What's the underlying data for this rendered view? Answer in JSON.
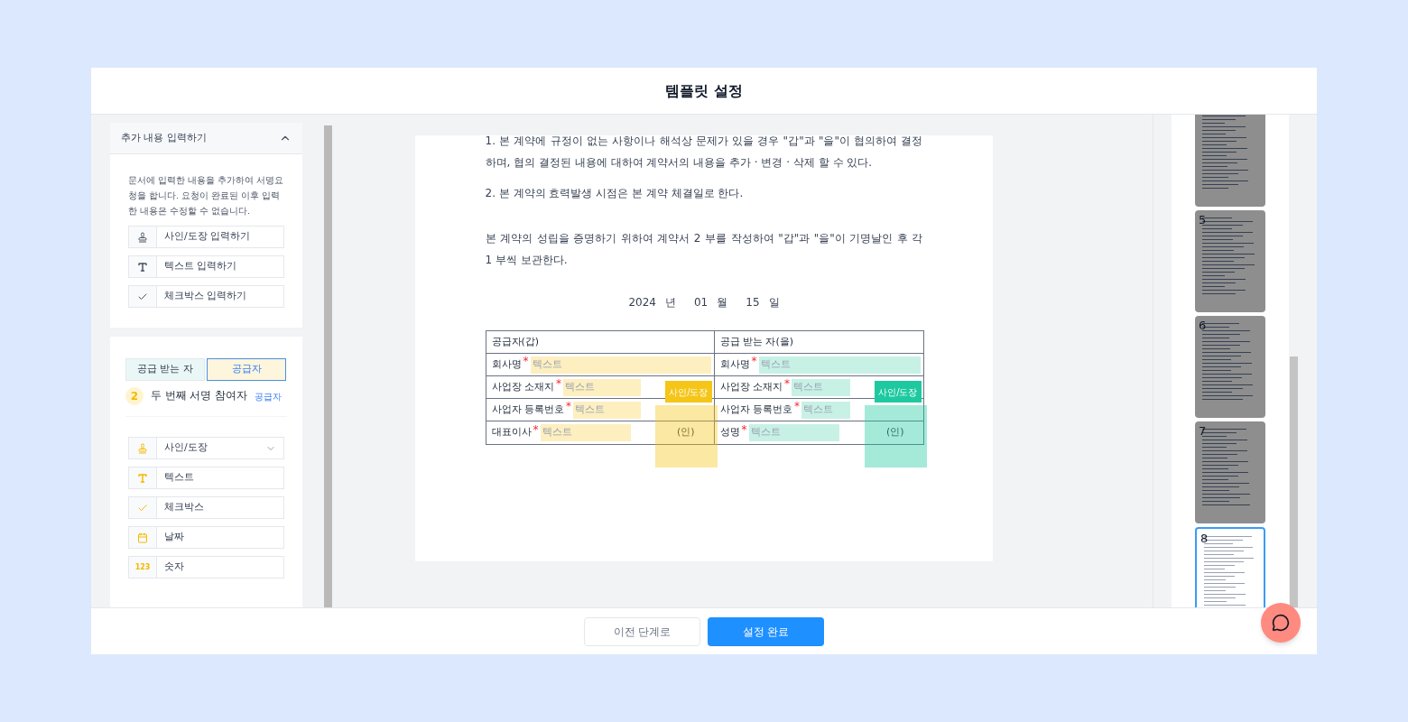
{
  "window": {
    "title": "템플릿 설정"
  },
  "extra_panel": {
    "title": "추가 내용 입력하기",
    "expanded": true,
    "description": "문서에 입력한 내용을 추가하여 서명요청을 합니다. 요청이 완료된 이후 입력한 내용은 수정할 수 없습니다.",
    "items": [
      {
        "kind": "stamp",
        "label": "사인/도장 입력하기"
      },
      {
        "kind": "text",
        "label": "텍스트 입력하기"
      },
      {
        "kind": "check",
        "label": "체크박스 입력하기"
      }
    ]
  },
  "participant_panel": {
    "tabs": [
      {
        "label": "공급 받는 자",
        "selected": false,
        "color": "#eaf7f7"
      },
      {
        "label": "공급자",
        "selected": true,
        "color": "#fdf5dc"
      }
    ],
    "step": "2",
    "title": "두 번째 서명 참여자",
    "role": "공급자",
    "items": [
      {
        "kind": "stamp",
        "label": "사인/도장",
        "dropdown": true
      },
      {
        "kind": "text",
        "label": "텍스트",
        "dropdown": false
      },
      {
        "kind": "check",
        "label": "체크박스",
        "dropdown": false
      },
      {
        "kind": "date",
        "label": "날짜",
        "dropdown": false
      },
      {
        "kind": "number",
        "label": "숫자",
        "icon_text": "123",
        "dropdown": false
      }
    ]
  },
  "document": {
    "paragraphs": [
      "1. 본 계약에 규정이 없는 사항이나 해석상 문제가 있을 경우 \"갑\"과 \"을\"이 협의하여 결정하며, 협의 결정된 내용에 대하여 계약서의 내용을 추가 · 변경 · 삭제 할 수 있다.",
      "2. 본 계약의 효력발생 시점은 본 계약 체결일로 한다.",
      "본 계약의 성립을 증명하기 위하여 계약서 2 부를 작성하여 \"갑\"과 \"을\"이 기명날인 후 각 1 부씩 보관한다."
    ],
    "date": [
      "2024",
      "년",
      "01",
      "월",
      "15",
      "일"
    ],
    "parties": [
      {
        "header": "공급자(갑)",
        "color": "#fdefc0",
        "seal": "(인)",
        "stamp": {
          "label": "사인/도장",
          "color": "#f5c518"
        },
        "fields": [
          {
            "label": "회사명",
            "mark": "*",
            "placeholder": "텍스트"
          },
          {
            "label": "사업장 소재지",
            "mark": "*",
            "placeholder": "텍스트"
          },
          {
            "label": "사업자 등록번호",
            "mark": "*",
            "placeholder": "텍스트"
          },
          {
            "label": "대표이사",
            "mark": "*",
            "placeholder": "텍스트"
          }
        ]
      },
      {
        "header": "공급 받는 자(을)",
        "color": "#c8f1e6",
        "seal": "(인)",
        "stamp": {
          "label": "사인/도장",
          "color": "#1ec9a0"
        },
        "fields": [
          {
            "label": "회사명",
            "mark": "*",
            "placeholder": "텍스트"
          },
          {
            "label": "사업장 소재지",
            "mark": "*",
            "placeholder": "텍스트"
          },
          {
            "label": "사업자 등록번호",
            "mark": "*",
            "placeholder": "텍스트"
          },
          {
            "label": "성명",
            "mark": "*",
            "placeholder": "텍스트"
          }
        ]
      }
    ]
  },
  "thumbnails": [
    {
      "selected": false
    },
    {
      "number": "5",
      "selected": false
    },
    {
      "number": "6",
      "selected": false
    },
    {
      "number": "7",
      "selected": false
    },
    {
      "number": "8",
      "selected": true
    }
  ],
  "footer": {
    "buttons": [
      {
        "label": "이전 단계로",
        "kind": "secondary"
      },
      {
        "label": "설정 완료",
        "kind": "primary"
      }
    ]
  }
}
